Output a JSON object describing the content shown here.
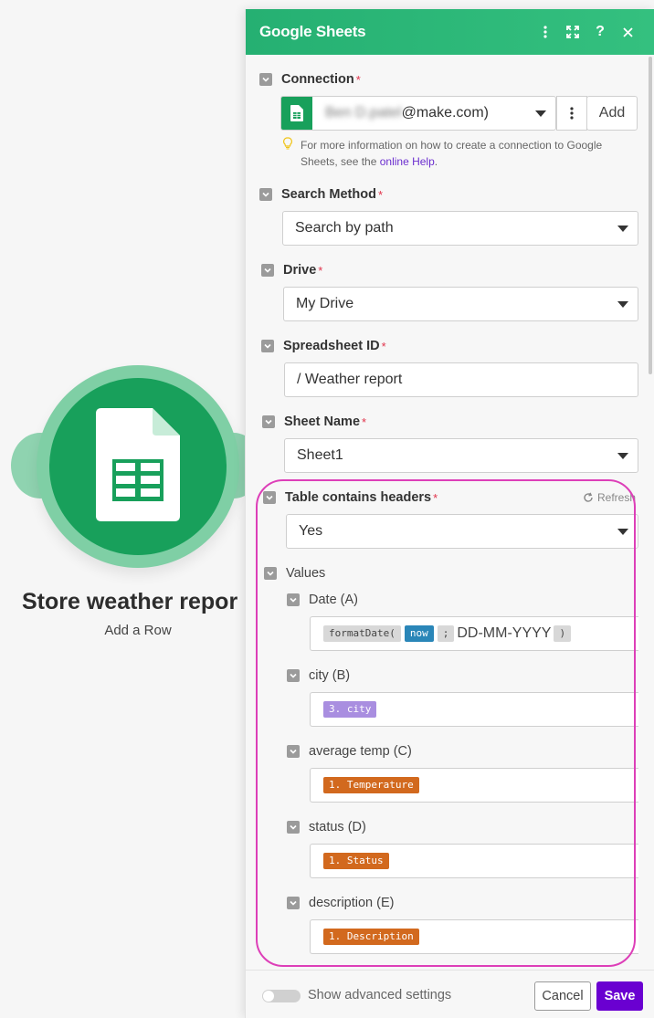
{
  "module": {
    "title": "Store weather repor",
    "subtitle": "Add a Row"
  },
  "panel": {
    "title": "Google Sheets",
    "header_icons": [
      "more-vertical-icon",
      "expand-icon",
      "help-icon",
      "close-icon"
    ]
  },
  "connection": {
    "label": "Connection",
    "value": "@make.com)",
    "value_blurred": "Ben D.patel",
    "add_label": "Add",
    "hint_text": "For more information on how to create a connection to Google Sheets, see the ",
    "hint_link": "online Help",
    "hint_end": "."
  },
  "search_method": {
    "label": "Search Method",
    "value": "Search by path"
  },
  "drive": {
    "label": "Drive",
    "value": "My Drive"
  },
  "spreadsheet": {
    "label": "Spreadsheet ID",
    "value": "/ Weather report"
  },
  "sheet_name": {
    "label": "Sheet Name",
    "value": "Sheet1"
  },
  "headers": {
    "label": "Table contains headers",
    "refresh": "Refresh",
    "value": "Yes"
  },
  "values": {
    "label": "Values",
    "date": {
      "label": "Date (A)",
      "fn": "formatDate(",
      "arg1": "now",
      "sep": ";",
      "format": "DD-MM-YYYY",
      "close": ")"
    },
    "city": {
      "label": "city (B)",
      "pill": "3. city"
    },
    "avg_temp": {
      "label": "average temp (C)",
      "pill": "1. Temperature"
    },
    "status": {
      "label": "status (D)",
      "pill": "1. Status"
    },
    "description": {
      "label": "description (E)",
      "pill": "1. Description"
    }
  },
  "footer": {
    "advanced": "Show advanced settings",
    "cancel": "Cancel",
    "save": "Save"
  },
  "colors": {
    "brand_green": "#25b072",
    "save_purple": "#6a00d1",
    "highlight": "#dd3fb8"
  }
}
